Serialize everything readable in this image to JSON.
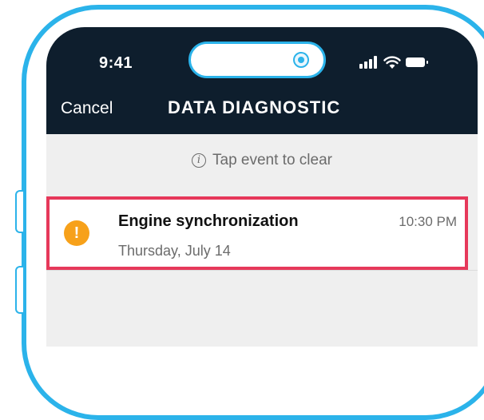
{
  "status_bar": {
    "time": "9:41"
  },
  "header": {
    "cancel_label": "Cancel",
    "title": "DATA DIAGNOSTIC"
  },
  "hint": {
    "text": "Tap event to clear",
    "icon": "info-icon"
  },
  "event": {
    "name": "Engine synchronization",
    "time": "10:30 PM",
    "date": "Thursday, July 14",
    "icon": "warning-icon",
    "icon_glyph": "!"
  },
  "colors": {
    "frame": "#2bb3ea",
    "header_bg": "#0e1e2d",
    "highlight_border": "#e6385a",
    "warning": "#f7a11a",
    "screen_bg": "#efefef"
  }
}
